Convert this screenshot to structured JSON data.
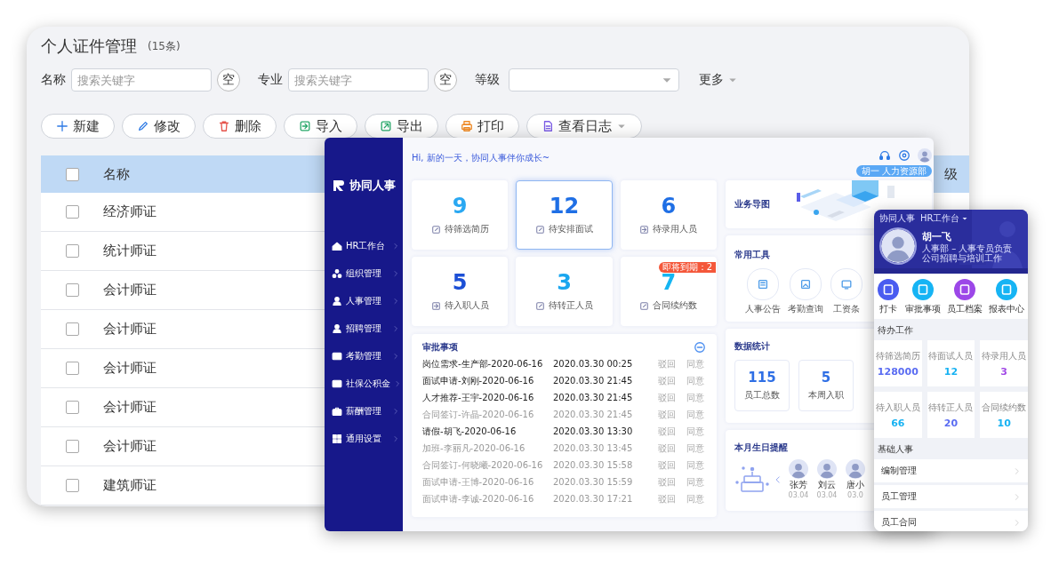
{
  "back_window": {
    "title": "个人证件管理",
    "count": "(15条)",
    "filters": [
      {
        "kind": "text",
        "label": "名称",
        "placeholder": "搜索关键字",
        "clear": "空"
      },
      {
        "kind": "text",
        "label": "专业",
        "placeholder": "搜索关键字",
        "clear": "空"
      },
      {
        "kind": "select",
        "label": "等级"
      }
    ],
    "more": "更多",
    "toolbar": [
      {
        "label": "新建"
      },
      {
        "label": "修改"
      },
      {
        "label": "删除"
      },
      {
        "label": "导入"
      },
      {
        "label": "导出"
      },
      {
        "label": "打印"
      },
      {
        "label": "查看日志",
        "dropdown": true
      }
    ],
    "table": {
      "header_checked": false,
      "columns": [
        {
          "label": "名称"
        },
        {
          "label": "级"
        }
      ],
      "rows": [
        {
          "name": "经济师证",
          "checked": false
        },
        {
          "name": "统计师证",
          "checked": false
        },
        {
          "name": "会计师证",
          "checked": false
        },
        {
          "name": "会计师证",
          "checked": false
        },
        {
          "name": "会计师证",
          "checked": false
        },
        {
          "name": "会计师证",
          "checked": false
        },
        {
          "name": "会计师证",
          "checked": false
        },
        {
          "name": "建筑师证",
          "checked": false
        }
      ]
    }
  },
  "dashboard": {
    "logo": "协同人事",
    "sidebar": [
      {
        "label": "HR工作台"
      },
      {
        "label": "组织管理"
      },
      {
        "label": "人事管理"
      },
      {
        "label": "招聘管理"
      },
      {
        "label": "考勤管理"
      },
      {
        "label": "社保公积金"
      },
      {
        "label": "薪酬管理"
      },
      {
        "label": "通用设置"
      }
    ],
    "greeting": "Hi, 新的一天，协同人事伴你成长~",
    "user_badge": "胡一 人力资源部",
    "stats": [
      {
        "value": "9",
        "label": "待筛选简历",
        "color": "#2aa8f2",
        "selected": false
      },
      {
        "value": "12",
        "label": "待安排面试",
        "color": "#1f6fe5",
        "selected": true
      },
      {
        "value": "6",
        "label": "待录用人员",
        "color": "#1f6fe5",
        "selected": false
      },
      {
        "value": "5",
        "label": "待入职人员",
        "color": "#1c4fd6",
        "selected": false
      },
      {
        "value": "3",
        "label": "待转正人员",
        "color": "#1aa6ef",
        "selected": false
      },
      {
        "value": "7",
        "label": "合同续约数",
        "color": "#15b5f2",
        "selected": false,
        "badge": "即将到期：2"
      }
    ],
    "approvals": {
      "title": "审批事项",
      "rows": [
        {
          "text": "岗位需求-生产部-2020-06-16",
          "time": "2020.03.30 00:25",
          "unread": true,
          "reject": "驳回",
          "approve": "同意"
        },
        {
          "text": "面试申请-刘刚-2020-06-16",
          "time": "2020.03.30 21:45",
          "unread": true,
          "reject": "驳回",
          "approve": "同意"
        },
        {
          "text": "人才推荐-王宇-2020-06-16",
          "time": "2020.03.30 21:45",
          "unread": true,
          "reject": "驳回",
          "approve": "同意"
        },
        {
          "text": "合同签订-许晶-2020-06-16",
          "time": "2020.03.30 21:45",
          "unread": false,
          "reject": "驳回",
          "approve": "同意"
        },
        {
          "text": "请假-胡飞-2020-06-16",
          "time": "2020.03.30 13:30",
          "unread": true,
          "reject": "驳回",
          "approve": "同意"
        },
        {
          "text": "加班-李丽凡-2020-06-16",
          "time": "2020.03.30 13:45",
          "unread": false,
          "reject": "驳回",
          "approve": "同意"
        },
        {
          "text": "合同签订-何晓曦-2020-06-16",
          "time": "2020.03.30 15:58",
          "unread": false,
          "reject": "驳回",
          "approve": "同意"
        },
        {
          "text": "面试申请-王博-2020-06-16",
          "time": "2020.03.30 15:59",
          "unread": false,
          "reject": "驳回",
          "approve": "同意"
        },
        {
          "text": "面试申请-李诚-2020-06-16",
          "time": "2020.03.30 17:21",
          "unread": false,
          "reject": "驳回",
          "approve": "同意"
        }
      ]
    },
    "business_map": {
      "title": "业务导图"
    },
    "tools": {
      "title": "常用工具",
      "items": [
        {
          "label": "人事公告"
        },
        {
          "label": "考勤查询"
        },
        {
          "label": "工资条"
        }
      ]
    },
    "data_stats": {
      "title": "数据统计",
      "items": [
        {
          "value": "115",
          "label": "员工总数"
        },
        {
          "value": "5",
          "label": "本周入职"
        }
      ]
    },
    "birthdays": {
      "title": "本月生日提醒",
      "people": [
        {
          "name": "张芳",
          "date": "03.04"
        },
        {
          "name": "刘云",
          "date": "03.04"
        },
        {
          "name": "唐小",
          "date": "03.0"
        }
      ]
    }
  },
  "mobile": {
    "app": "协同人事",
    "workspace": "HR工作台",
    "name": "胡一飞",
    "bio": [
      "人事部 – 人事专员负责",
      "公司招聘与培训工作"
    ],
    "actions": [
      {
        "label": "打卡",
        "color": "#4a5cf0"
      },
      {
        "label": "审批事项",
        "color": "#16b4f4"
      },
      {
        "label": "员工档案",
        "color": "#9c47e8"
      },
      {
        "label": "报表中心",
        "color": "#16b4f4"
      }
    ],
    "todo": {
      "title": "待办工作",
      "items": [
        {
          "label": "待筛选简历",
          "value": "128000",
          "color": "#5a6cf2"
        },
        {
          "label": "待面试人员",
          "value": "12",
          "color": "#17b2f2"
        },
        {
          "label": "待录用人员",
          "value": "3",
          "color": "#a24ae6"
        },
        {
          "label": "待入职人员",
          "value": "66",
          "color": "#17b2f2"
        },
        {
          "label": "待转正人员",
          "value": "20",
          "color": "#5a6cf2"
        },
        {
          "label": "合同续约数",
          "value": "10",
          "color": "#17b2f2"
        }
      ]
    },
    "basics": {
      "title": "基础人事",
      "items": [
        {
          "label": "编制管理"
        },
        {
          "label": "员工管理"
        },
        {
          "label": "员工合同"
        }
      ]
    }
  }
}
